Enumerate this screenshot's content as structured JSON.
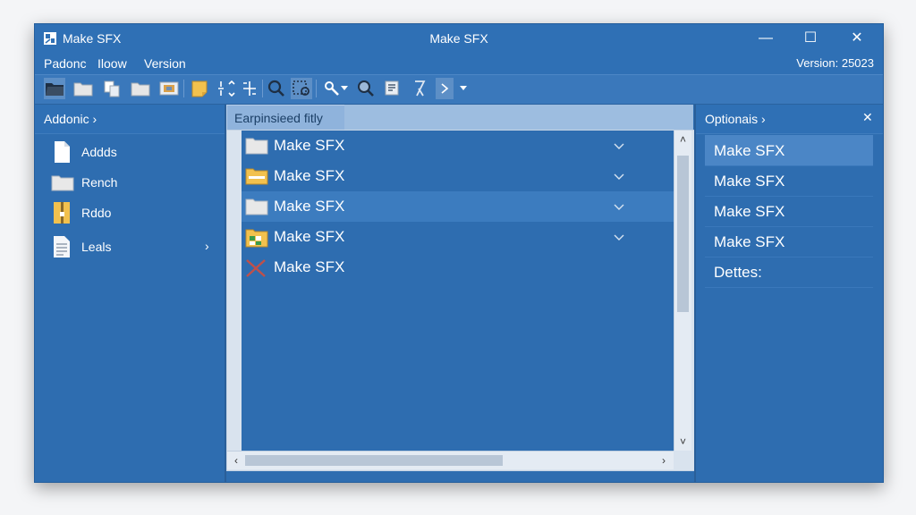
{
  "window": {
    "title_left": "Make SFX",
    "title_center": "Make SFX",
    "controls": {
      "minimize": "—",
      "maximize": "☐",
      "close": "✕"
    }
  },
  "menubar": {
    "items": [
      "Padonc",
      "Iloow",
      "Version"
    ],
    "version_label": "Version: 25023"
  },
  "toolbar": {
    "icons": [
      "open-folder-icon",
      "folder-icon",
      "copy-files-icon",
      "folder-icon",
      "image-icon",
      "note-icon",
      "split-icon",
      "merge-icon",
      "search-icon",
      "zoom-select-icon",
      "tools-icon",
      "magnifier-icon",
      "list-edit-icon",
      "filter-icon",
      "chevron-right-icon",
      "dropdown-icon"
    ]
  },
  "left_panel": {
    "header": "Addonic ›",
    "items": [
      {
        "label": "Addds",
        "icon": "document-icon",
        "arrow": ""
      },
      {
        "label": "Rench",
        "icon": "folder-icon",
        "arrow": ""
      },
      {
        "label": "Rddo",
        "icon": "archive-icon",
        "arrow": ""
      },
      {
        "label": "Leals",
        "icon": "text-file-icon",
        "arrow": "›"
      }
    ]
  },
  "center": {
    "tab_label": "Earpinsieed fitly",
    "rows": [
      {
        "label": "Make SFX",
        "icon": "folder-icon",
        "chevron": true,
        "selected": false
      },
      {
        "label": "Make SFX",
        "icon": "folder-yellow-icon",
        "chevron": true,
        "selected": false
      },
      {
        "label": "Make SFX",
        "icon": "folder-icon",
        "chevron": true,
        "selected": true
      },
      {
        "label": "Make SFX",
        "icon": "spreadsheet-icon",
        "chevron": true,
        "selected": false
      },
      {
        "label": "Make SFX",
        "icon": "x-mark-icon",
        "chevron": false,
        "selected": false
      }
    ],
    "scroll": {
      "up": "˄",
      "down": "˅",
      "left": "‹",
      "right": "›"
    }
  },
  "right_panel": {
    "header": "Optionais ›",
    "close": "✕",
    "items": [
      {
        "label": "Make SFX",
        "selected": true
      },
      {
        "label": "Make SFX",
        "selected": false
      },
      {
        "label": "Make SFX",
        "selected": false
      },
      {
        "label": "Make SFX",
        "selected": false
      },
      {
        "label": "Dettes:",
        "selected": false
      }
    ]
  },
  "colors": {
    "accent": "#2e6db0",
    "selection": "#4b86c6",
    "folder": "#e9e9e9",
    "folder_yellow": "#f2c14e"
  }
}
